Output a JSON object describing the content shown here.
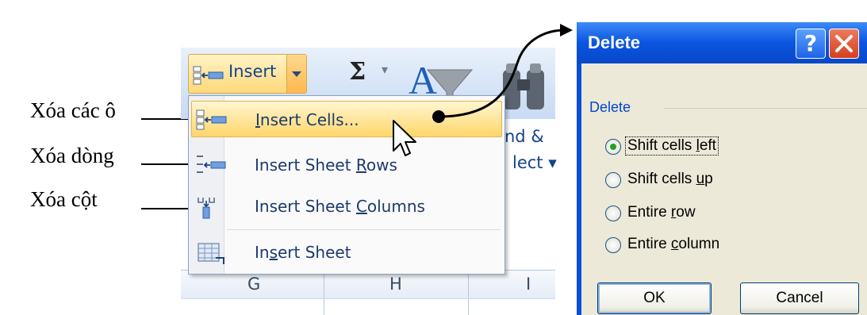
{
  "annotations": [
    {
      "label": "Xóa các ô"
    },
    {
      "label": "Xóa dòng"
    },
    {
      "label": "Xóa cột"
    }
  ],
  "ribbon": {
    "insert_label": "Insert",
    "sum_symbol": "Σ",
    "sum_caret": "▾",
    "find_label_line1": "nd &",
    "find_label_line2": "lect ▾"
  },
  "menu": {
    "items": [
      {
        "prefix": "",
        "access": "I",
        "suffix": "nsert Cells...",
        "icon": "insert-cells-icon",
        "highlighted": true
      },
      {
        "prefix": "Insert Sheet ",
        "access": "R",
        "suffix": "ows",
        "icon": "insert-sheet-rows-icon",
        "highlighted": false
      },
      {
        "prefix": "Insert Sheet ",
        "access": "C",
        "suffix": "olumns",
        "icon": "insert-sheet-columns-icon",
        "highlighted": false
      },
      {
        "prefix": "In",
        "access": "s",
        "suffix": "ert Sheet",
        "icon": "insert-sheet-icon",
        "highlighted": false
      }
    ]
  },
  "grid": {
    "columns": [
      "G",
      "H",
      "I"
    ]
  },
  "dialog": {
    "title": "Delete",
    "help_label": "?",
    "group_title": "Delete",
    "options": [
      {
        "prefix": "Shift cells ",
        "access": "l",
        "suffix": "eft",
        "selected": true
      },
      {
        "prefix": "Shift cells ",
        "access": "u",
        "suffix": "p",
        "selected": false
      },
      {
        "prefix": "Entire ",
        "access": "r",
        "suffix": "ow",
        "selected": false
      },
      {
        "prefix": "Entire ",
        "access": "c",
        "suffix": "olumn",
        "selected": false
      }
    ],
    "ok_label": "OK",
    "cancel_label": "Cancel"
  },
  "colors": {
    "dialog_title_bar": "#0a55e0",
    "dialog_body": "#ece9d8",
    "menu_highlight": "#ffd66b",
    "ribbon_text": "#15428b",
    "radio_selected": "#21a121"
  }
}
